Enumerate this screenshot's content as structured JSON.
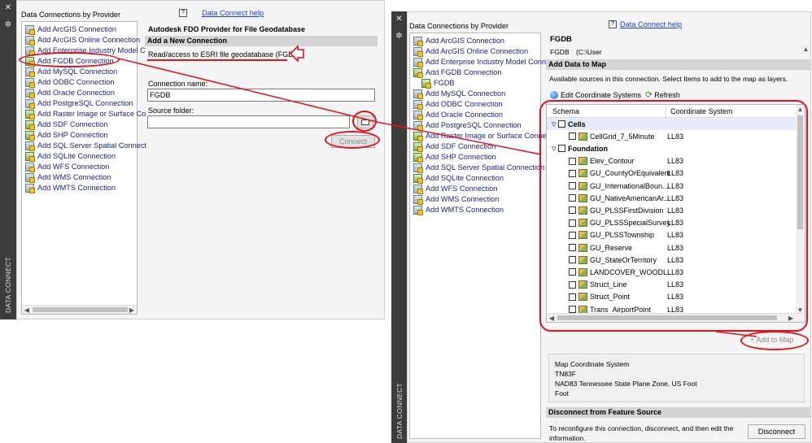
{
  "left": {
    "strip_label": "DATA CONNECT",
    "providers_header": "Data Connections by Provider",
    "help_link": "Data Connect help",
    "providers": [
      {
        "label": "Add ArcGIS Connection",
        "green": false
      },
      {
        "label": "Add ArcGIS Online Connection",
        "green": false
      },
      {
        "label": "Add Enterprise Industry Model C",
        "green": false
      },
      {
        "label": "Add FGDB Connection",
        "green": true
      },
      {
        "label": "Add MySQL Connection",
        "green": false
      },
      {
        "label": "Add ODBC Connection",
        "green": false
      },
      {
        "label": "Add Oracle Connection",
        "green": false
      },
      {
        "label": "Add PostgreSQL Connection",
        "green": false
      },
      {
        "label": "Add Raster Image or Surface Co",
        "green": true
      },
      {
        "label": "Add SDF Connection",
        "green": true
      },
      {
        "label": "Add SHP Connection",
        "green": true
      },
      {
        "label": "Add SQL Server Spatial Connect",
        "green": false
      },
      {
        "label": "Add SQLite Connection",
        "green": true
      },
      {
        "label": "Add WFS Connection",
        "green": false
      },
      {
        "label": "Add WMS Connection",
        "green": false
      },
      {
        "label": "Add WMTS Connection",
        "green": false
      }
    ],
    "provider_title": "Autodesk FDO Provider for File Geodatabase",
    "section_new": "Add a New Connection",
    "description": "Read/access to ESRI file geodatabase (FGDB)",
    "conn_name_label": "Connection name:",
    "conn_name_value": "FGDB",
    "source_folder_label": "Source folder:",
    "source_folder_value": "",
    "connect_button": "Connect"
  },
  "right": {
    "strip_label": "DATA CONNECT",
    "providers_header": "Data Connections by Provider",
    "help_link": "Data Connect help",
    "providers": [
      {
        "label": "Add ArcGIS Connection",
        "green": false,
        "indent": 0
      },
      {
        "label": "Add ArcGIS Online Connection",
        "green": false,
        "indent": 0
      },
      {
        "label": "Add Enterprise Industry Model Conn",
        "green": false,
        "indent": 0
      },
      {
        "label": "Add FGDB Connection",
        "green": true,
        "indent": 0
      },
      {
        "label": "FGDB",
        "green": true,
        "indent": 1
      },
      {
        "label": "Add MySQL Connection",
        "green": false,
        "indent": 0
      },
      {
        "label": "Add ODBC Connection",
        "green": false,
        "indent": 0
      },
      {
        "label": "Add Oracle Connection",
        "green": false,
        "indent": 0
      },
      {
        "label": "Add PostgreSQL Connection",
        "green": false,
        "indent": 0
      },
      {
        "label": "Add Raster Image or Surface Connect",
        "green": true,
        "indent": 0
      },
      {
        "label": "Add SDF Connection",
        "green": true,
        "indent": 0
      },
      {
        "label": "Add SHP Connection",
        "green": true,
        "indent": 0
      },
      {
        "label": "Add SQL Server Spatial Connection",
        "green": false,
        "indent": 0
      },
      {
        "label": "Add SQLite Connection",
        "green": true,
        "indent": 0
      },
      {
        "label": "Add WFS Connection",
        "green": false,
        "indent": 0
      },
      {
        "label": "Add WMS Connection",
        "green": false,
        "indent": 0
      },
      {
        "label": "Add WMTS Connection",
        "green": false,
        "indent": 0
      }
    ],
    "conn_title": "FGDB",
    "conn_path_label": "FGDB",
    "conn_path_value": "(C:\\User",
    "section_add": "Add Data to Map",
    "available_text": "Available sources in this connection.  Select Items to add to the map as layers.",
    "edit_coord_button": "Edit Coordinate Systems",
    "refresh_button": "Refresh",
    "col_schema": "Schema",
    "col_coord": "Coordinate System",
    "tree": [
      {
        "label": "Cells",
        "type": "group",
        "coord": ""
      },
      {
        "label": "CellGrid_7_5Minute",
        "type": "item",
        "coord": "LL83"
      },
      {
        "label": "Foundation",
        "type": "group",
        "coord": ""
      },
      {
        "label": "Elev_Contour",
        "type": "item",
        "coord": "LL83"
      },
      {
        "label": "GU_CountyOrEquivalent",
        "type": "item",
        "coord": "LL83"
      },
      {
        "label": "GU_InternationalBoun...",
        "type": "item",
        "coord": "LL83"
      },
      {
        "label": "GU_NativeAmericanAr...",
        "type": "item",
        "coord": "LL83"
      },
      {
        "label": "GU_PLSSFirstDivision",
        "type": "item",
        "coord": "LL83"
      },
      {
        "label": "GU_PLSSSpecialSurvey",
        "type": "item",
        "coord": "LL83"
      },
      {
        "label": "GU_PLSSTownship",
        "type": "item",
        "coord": "LL83"
      },
      {
        "label": "GU_Reserve",
        "type": "item",
        "coord": "LL83"
      },
      {
        "label": "GU_StateOrTerritory",
        "type": "item",
        "coord": "LL83"
      },
      {
        "label": "LANDCOVER_WOODL...",
        "type": "item",
        "coord": "LL83"
      },
      {
        "label": "Struct_Line",
        "type": "item",
        "coord": "LL83"
      },
      {
        "label": "Struct_Point",
        "type": "item",
        "coord": "LL83"
      },
      {
        "label": "Trans_AirportPoint",
        "type": "item",
        "coord": "LL83"
      }
    ],
    "add_to_map_button": "Add to Map",
    "map_coord_title": "Map Coordinate System",
    "map_coord_code": "TN83F",
    "map_coord_name": "NAD83 Tennessee State Plane Zone, US Foot",
    "map_coord_unit": "Foot",
    "section_disconnect": "Disconnect from Feature Source",
    "disconnect_text": "To reconfigure this connection, disconnect, and then edit the information.",
    "disconnect_button": "Disconnect"
  },
  "colors": {
    "annotation": "#e0141e",
    "link": "#1a3ed6",
    "strip": "#3c3c3c"
  }
}
